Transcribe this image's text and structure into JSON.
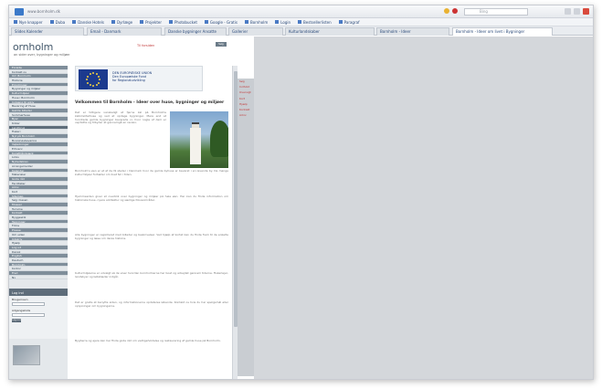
{
  "browser": {
    "url": "www.bornholm.dk",
    "search_placeholder": "Bing",
    "favorites": [
      "Nye knapper",
      "Duba",
      "Danske Hotels",
      "Dyrlæge",
      "Projekter",
      "Photobucket",
      "Google - Gratis",
      "Bornholm",
      "Login",
      "Bestsellerlisten",
      "Paragraf"
    ],
    "tabs": [
      "Slides Kalender",
      "Email - Danmark",
      "Danske bygninger Ansatte",
      "Gallerier",
      "Kulturlandskaber",
      "Bornholm - Ideer",
      "Bornholm - Ideer om livet i Bygninger"
    ]
  },
  "site": {
    "logo": "ornholm",
    "tagline": "an sider over, bygninger og miljøer",
    "top_link": "Til forsiden",
    "top_button": "Søg",
    "nav_items": [
      "Forside",
      "Kontakt os",
      "Om Bornholm",
      "Historie",
      "Erindringer",
      "Bygninger og miljøer",
      "Kulturmiljøer",
      "Huse i Bornholm",
      "Indgang til arkiv",
      "Bevaring af Huse",
      "Gamle billeder",
      "Sommerhuse",
      "Byer",
      "Kirker",
      "Landbrug",
      "Fiskeri",
      "Nyt på Bornholm",
      "Bygningsbevaring",
      "Vejledninger",
      "Erhverv",
      "Kunsthåndværk",
      "Links",
      "Nyhedsbrev",
      "Arrangementer",
      "Kalender",
      "Materialer",
      "Gode råd",
      "Faciliteter",
      "Arkiv",
      "Kort",
      "Sitemap",
      "Søg i basen",
      "Museer",
      "Turisme",
      "Kontakt",
      "Byggeskik",
      "Tegninger",
      "Fotos",
      "Presse",
      "Om siden",
      "Udskriv",
      "Hjælp",
      "Log ud",
      "Dansk",
      "English",
      "Deutsch",
      "Bornholm",
      "Kontor",
      "Fred",
      "Ny"
    ],
    "login": {
      "title": "Log ind",
      "user_label": "Brugernavn",
      "pass_label": "Adgangskode",
      "button": "Log ind"
    },
    "eu_banner": "DEN EUROPÆISKE UNION\nDen Europæiske Fond\nfor Regionaludvikling",
    "content_title": "Velkommen til Bornholm - Ideer over huse, bygninger og miljøer",
    "paragraphs": [
      "Det er tidligere vanskeligt at fjerne kal på Bornholms kalkmørtelhuse og ved at opdage bygninger. Mere end et hundrede gamle bygninger bevarede vi, hvor nogle af dem er vejrbidte og tilbyder at gennemgå en revisio.",
      "Bornholm's øen er et af de få steder i Danmark hvor de gamle byhuse er bevaret i en levende by. De mange kulturmiljøer fortæller om livet før i tiden.",
      "Hjemmesiden giver et overblik over bygninger og miljøer på hele øen. Her kan du finde information om historiske huse, nyere arkitektur og særlige fokusområder.",
      "Alle bygninger er registreret med billeder og beskrivelser. Ved hjælp af kortet kan du finde frem til de enkelte bygninger og læse om deres historie.",
      "Kulturmiljøerne er udvalgt så de viser hvordan bornholmerne har boet og arbejdet gennem tiderne. Fiskerlejer, landsbyer og købstæder indgår.",
      "Det er gratis at benytte siden, og informationerne opdateres løbende. Kontakt os hvis du har spørgsmål eller oplysninger om bygningerne.",
      "Bygherre og ejere kan her finde gode råd om vedligeholdelse og restaurering af gamle huse på Bornholm."
    ],
    "right_links": [
      "Søg",
      "Indhold",
      "Oversigt",
      "Kort",
      "Hjælp",
      "Kontakt",
      "Arkiv"
    ]
  },
  "colors": {
    "accent": "#5e6d7a",
    "link": "#c23b3b",
    "eu_blue": "#1c3a8e"
  }
}
